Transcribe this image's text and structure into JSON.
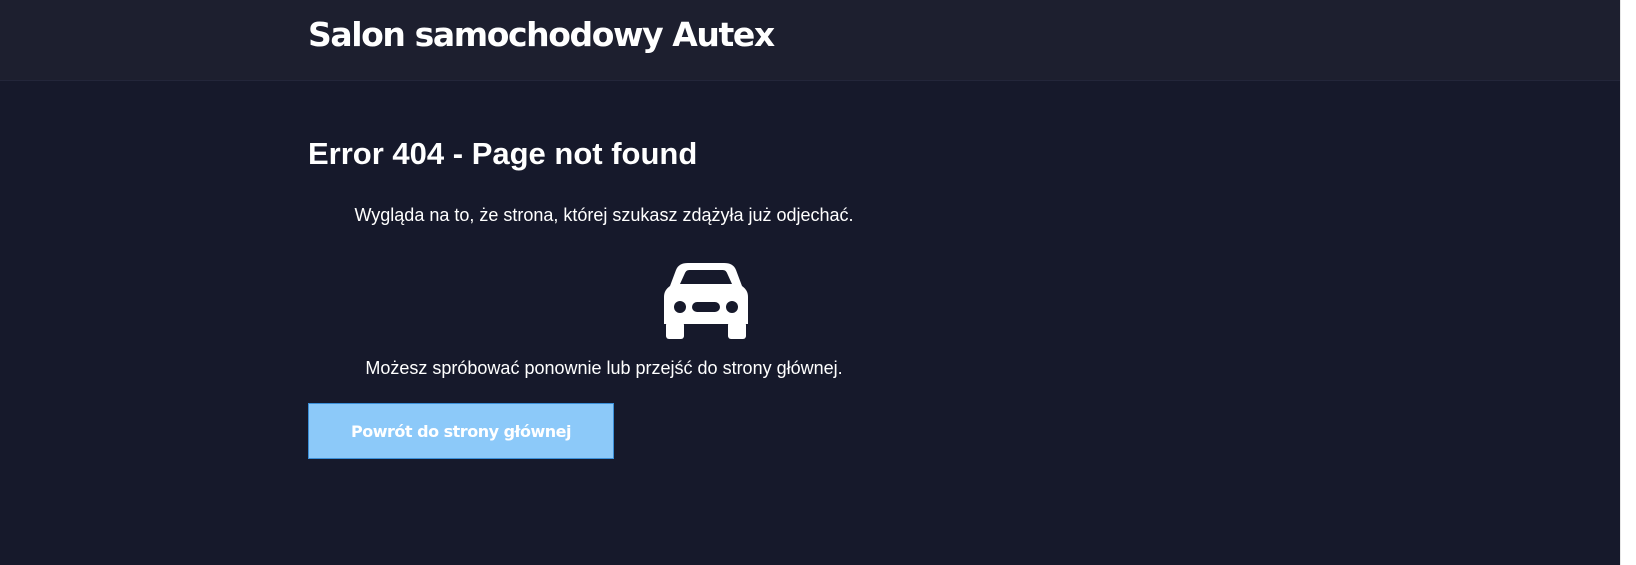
{
  "header": {
    "brand": "Salon samochodowy Autex"
  },
  "main": {
    "title": "Error 404 - Page not found",
    "message_primary": "Wygląda na to, że strona, której szukasz zdążyła już odjechać.",
    "message_secondary": "Możesz spróbować ponownie lub przejść do strony głównej.",
    "icon": "car-icon",
    "back_button_label": "Powrót do strony głównej"
  },
  "colors": {
    "background": "#16192b",
    "header_background": "#1d1f2f",
    "text": "#ffffff",
    "button_background": "#8cc9f9",
    "button_border": "#3b8fd8"
  }
}
